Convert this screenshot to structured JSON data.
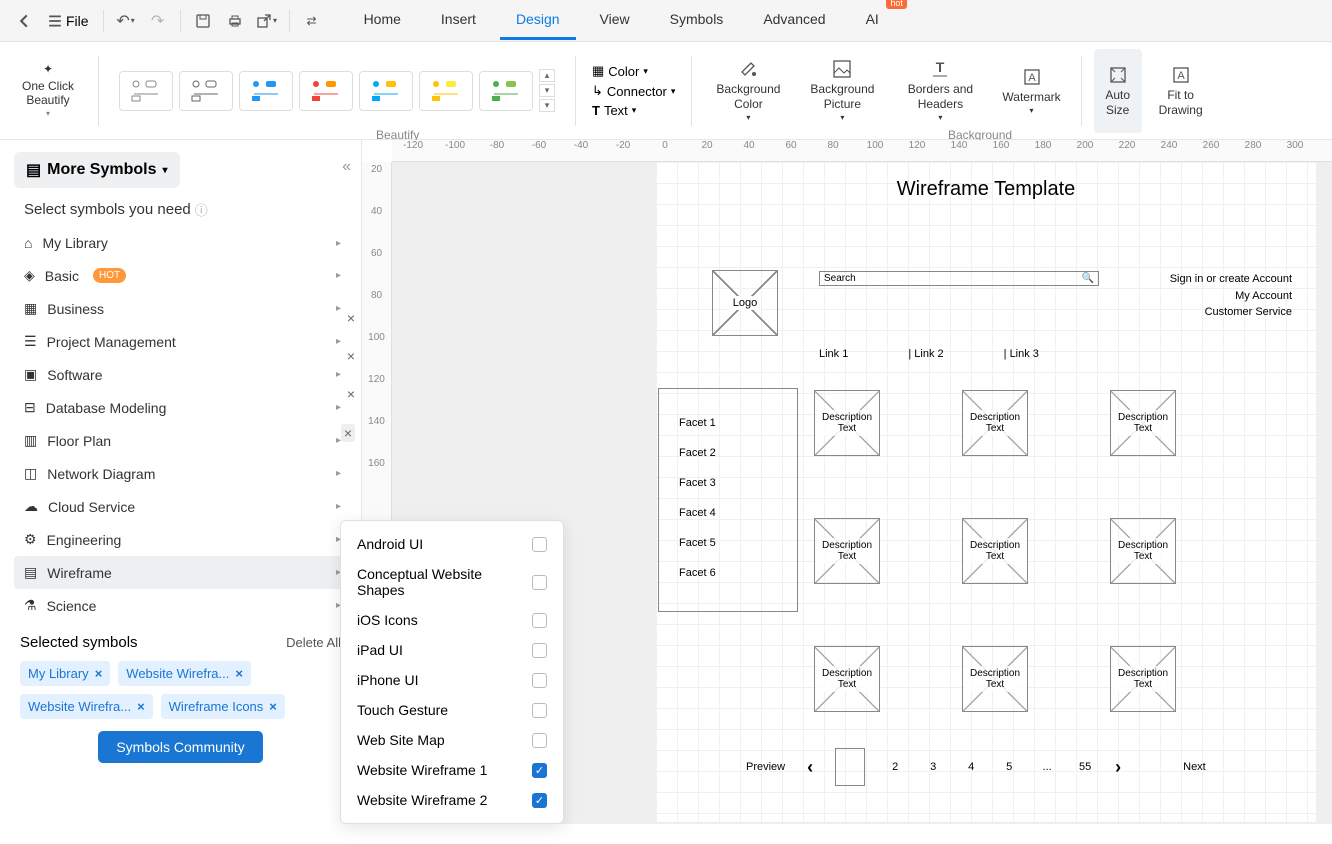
{
  "topbar": {
    "file_label": "File"
  },
  "tabs": {
    "home": "Home",
    "insert": "Insert",
    "design": "Design",
    "view": "View",
    "symbols": "Symbols",
    "advanced": "Advanced",
    "ai": "AI",
    "hot_badge": "hot"
  },
  "ribbon": {
    "one_click": "One Click Beautify",
    "color": "Color",
    "connector": "Connector",
    "text": "Text",
    "bg_color": "Background Color",
    "bg_picture": "Background Picture",
    "borders_headers": "Borders and Headers",
    "watermark": "Watermark",
    "auto_size": "Auto Size",
    "fit_drawing": "Fit to Drawing",
    "beautify_label": "Beautify",
    "background_label": "Background"
  },
  "sidebar": {
    "more_symbols": "More Symbols",
    "select_prompt": "Select symbols you need",
    "categories": {
      "my_library": "My Library",
      "basic": "Basic",
      "basic_hot": "HOT",
      "business": "Business",
      "project_mgmt": "Project Management",
      "software": "Software",
      "database": "Database Modeling",
      "floor_plan": "Floor Plan",
      "network": "Network Diagram",
      "cloud": "Cloud Service",
      "engineering": "Engineering",
      "wireframe": "Wireframe",
      "science": "Science"
    },
    "selected_title": "Selected symbols",
    "delete_all": "Delete All",
    "chips": {
      "c0": "My Library",
      "c1": "Website Wirefra...",
      "c2": "Website Wirefra...",
      "c3": "Wireframe Icons"
    },
    "community_btn": "Symbols Community"
  },
  "submenu": {
    "android": "Android UI",
    "conceptual": "Conceptual Website Shapes",
    "ios_icons": "iOS Icons",
    "ipad": "iPad UI",
    "iphone": "iPhone UI",
    "touch": "Touch Gesture",
    "sitemap": "Web Site Map",
    "wf1": "Website Wireframe 1",
    "wf2": "Website Wireframe 2"
  },
  "ruler_h": [
    "-120",
    "-100",
    "-80",
    "-60",
    "-40",
    "-20",
    "0",
    "20",
    "40",
    "60",
    "80",
    "100",
    "120",
    "140",
    "160",
    "180",
    "200",
    "220",
    "240",
    "260",
    "280",
    "300"
  ],
  "ruler_v": [
    "20",
    "40",
    "60",
    "80",
    "100",
    "120",
    "140",
    "160"
  ],
  "canvas": {
    "title": "Wireframe Template",
    "logo": "Logo",
    "search_placeholder": "Search",
    "account": {
      "signin": "Sign in or create Account",
      "myacct": "My Account",
      "cs": "Customer Service"
    },
    "links": {
      "l1": "Link 1",
      "l2": "Link 2",
      "l3": "Link 3"
    },
    "facets": {
      "f1": "Facet 1",
      "f2": "Facet 2",
      "f3": "Facet 3",
      "f4": "Facet 4",
      "f5": "Facet 5",
      "f6": "Facet 6"
    },
    "desc_text": "Description Text",
    "pager": {
      "preview": "Preview",
      "p2": "2",
      "p3": "3",
      "p4": "4",
      "p5": "5",
      "dots": "...",
      "p55": "55",
      "next": "Next"
    }
  }
}
